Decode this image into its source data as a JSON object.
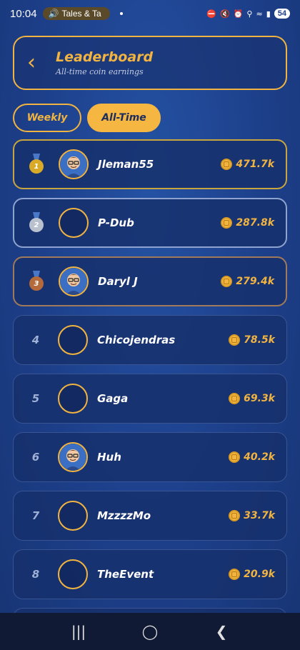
{
  "status_bar": {
    "time": "10:04",
    "media_label": "Tales & Ta",
    "battery": "54"
  },
  "header": {
    "title": "Leaderboard",
    "subtitle": "All-time coin earnings"
  },
  "tabs": [
    {
      "label": "Weekly",
      "active": false
    },
    {
      "label": "All-Time",
      "active": true
    }
  ],
  "leaderboard": [
    {
      "rank": "1",
      "name": "Jleman55",
      "coins": "471.7k",
      "medal": "gold",
      "has_avatar": true
    },
    {
      "rank": "2",
      "name": "P-Dub",
      "coins": "287.8k",
      "medal": "silver",
      "has_avatar": false
    },
    {
      "rank": "3",
      "name": "Daryl J",
      "coins": "279.4k",
      "medal": "bronze",
      "has_avatar": true
    },
    {
      "rank": "4",
      "name": "Chicojendras",
      "coins": "78.5k",
      "medal": "",
      "has_avatar": false
    },
    {
      "rank": "5",
      "name": "Gaga",
      "coins": "69.3k",
      "medal": "",
      "has_avatar": false
    },
    {
      "rank": "6",
      "name": "Huh",
      "coins": "40.2k",
      "medal": "",
      "has_avatar": true
    },
    {
      "rank": "7",
      "name": "MzzzzMo",
      "coins": "33.7k",
      "medal": "",
      "has_avatar": false
    },
    {
      "rank": "8",
      "name": "TheEvent",
      "coins": "20.9k",
      "medal": "",
      "has_avatar": false
    }
  ],
  "colors": {
    "accent": "#f2b441",
    "background": "#1d3f8a",
    "gold": "#d9a928",
    "silver": "#b9c1cf",
    "bronze": "#b46a3a"
  }
}
